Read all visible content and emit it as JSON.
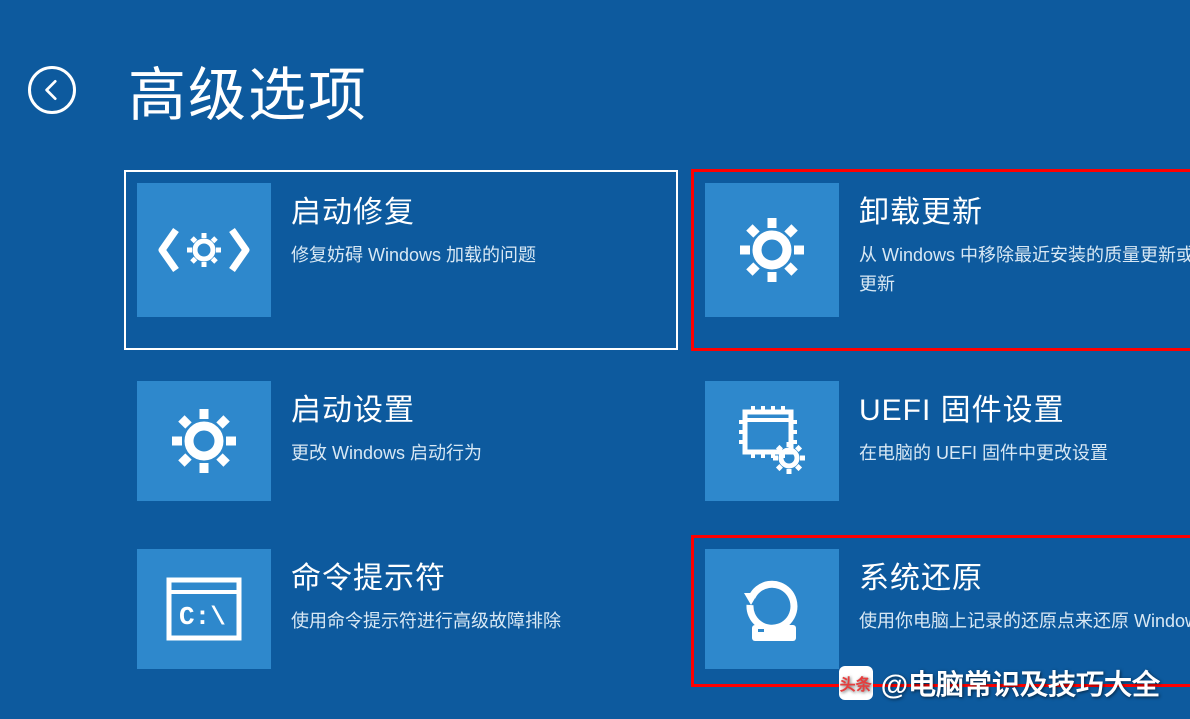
{
  "header": {
    "title": "高级选项"
  },
  "options": [
    {
      "icon": "code-gear",
      "title": "启动修复",
      "desc": "修复妨碍 Windows 加载的问题",
      "state": "selected"
    },
    {
      "icon": "gear",
      "title": "卸载更新",
      "desc": "从 Windows 中移除最近安装的质量更新或功能更新",
      "state": "highlighted"
    },
    {
      "icon": "gear",
      "title": "启动设置",
      "desc": "更改 Windows 启动行为",
      "state": "normal"
    },
    {
      "icon": "uefi-chip",
      "title": "UEFI 固件设置",
      "desc": "在电脑的 UEFI 固件中更改设置",
      "state": "normal"
    },
    {
      "icon": "cmd",
      "title": "命令提示符",
      "desc": "使用命令提示符进行高级故障排除",
      "state": "normal"
    },
    {
      "icon": "restore",
      "title": "系统还原",
      "desc": "使用你电脑上记录的还原点来还原 Windows",
      "state": "highlighted"
    }
  ],
  "watermark": {
    "prefix": "头条",
    "text": "@电脑常识及技巧大全"
  }
}
